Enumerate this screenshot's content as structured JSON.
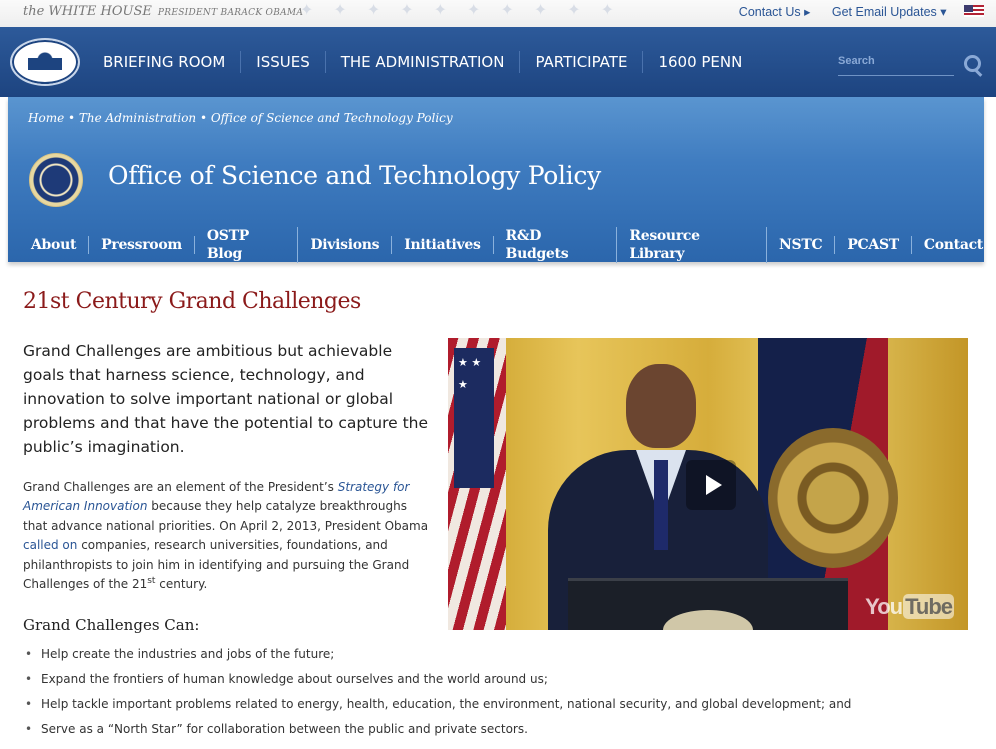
{
  "utility": {
    "brand": "the WHITE HOUSE",
    "brand_sub": "PRESIDENT BARACK OBAMA",
    "contact_link": "Contact Us ▸",
    "email_link": "Get Email Updates ▾",
    "flag_icon": "us-flag-icon"
  },
  "mainnav": {
    "items": [
      "BRIEFING ROOM",
      "ISSUES",
      "THE ADMINISTRATION",
      "PARTICIPATE",
      "1600 PENN"
    ],
    "search_placeholder": "Search",
    "search_icon": "search-icon"
  },
  "office": {
    "breadcrumb": "Home • The Administration • Office of Science and Technology Policy",
    "title": "Office of Science and Technology Policy",
    "subnav": [
      "About",
      "Pressroom",
      "OSTP Blog",
      "Divisions",
      "Initiatives",
      "R&D Budgets",
      "Resource Library",
      "NSTC",
      "PCAST",
      "Contact"
    ]
  },
  "content": {
    "title": "21st Century Grand Challenges",
    "lead": "Grand Challenges are ambitious but achievable goals that harness science, technology, and innovation to solve important national or global problems and that have the potential to capture the public’s imagination.",
    "para": {
      "t1": "Grand Challenges are an element of the President’s ",
      "link1": "Strategy for American Innovation",
      "t2": " because they help catalyze breakthroughs that advance national priorities. On April 2, 2013, President Obama ",
      "link2": "called on",
      "t3": " companies, research universities, foundations, and philanthropists to join him in identifying and pursuing the Grand Challenges of the 21",
      "sup": "st",
      "t4": " century."
    },
    "video": {
      "play_icon": "play-icon",
      "logo_you": "You",
      "logo_tube": "Tube"
    },
    "list_heading": "Grand Challenges Can:",
    "bullets": [
      "Help create the industries and jobs of the future;",
      "Expand the frontiers of human knowledge about ourselves and the world around us;",
      "Help tackle important problems related to energy, health, education, the environment, national security, and global development; and",
      "Serve as a “North Star” for collaboration between the public and private sectors."
    ]
  },
  "colors": {
    "nav_blue": "#1d4480",
    "header_blue": "#3f7cc0",
    "title_red": "#8b1a1a",
    "link_blue": "#2a5595"
  }
}
